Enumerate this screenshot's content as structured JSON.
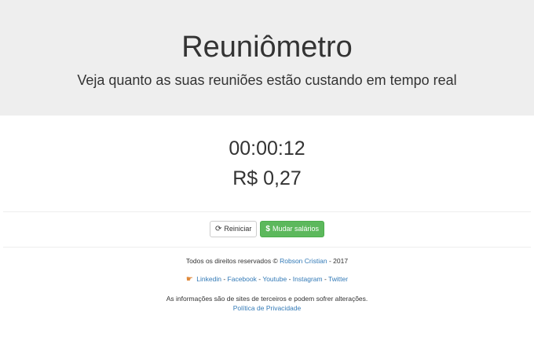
{
  "header": {
    "title": "Reuniômetro",
    "subtitle": "Veja quanto as suas reuniões estão custando em tempo real"
  },
  "meter": {
    "elapsed": "00:00:12",
    "cost": "R$ 0,27"
  },
  "actions": {
    "restart_label": "Reiniciar",
    "change_salaries_label": "Mudar salários"
  },
  "footer": {
    "rights_prefix": "Todos os direitos reservados ©",
    "author": "Robson Cristian",
    "rights_suffix": "- 2017",
    "social": {
      "linkedin": "Linkedin",
      "facebook": "Facebook",
      "youtube": "Youtube",
      "instagram": "Instagram",
      "twitter": "Twitter",
      "separator": "-"
    },
    "disclaimer": "As informações são de sites de terceiros e podem sofrer alterações.",
    "privacy": "Política de Privacidade"
  },
  "icons": {
    "restart": "refresh-icon",
    "money": "dollar-icon",
    "social": "pointing-hand-icon"
  },
  "colors": {
    "jumbotron_bg": "#eeeeee",
    "success": "#5cb85c",
    "link": "#337ab7"
  }
}
